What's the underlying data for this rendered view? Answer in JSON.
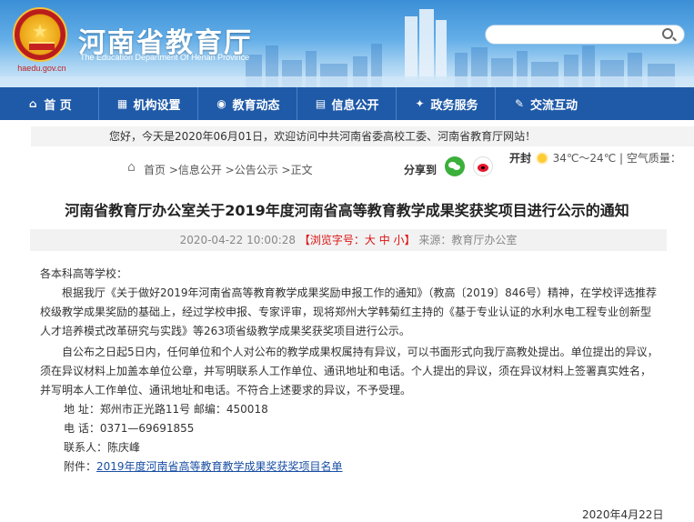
{
  "header": {
    "site_title": "河南省教育厅",
    "site_subtitle": "The Education Department Of Henan Province",
    "domain": "haedu.gov.cn",
    "search_placeholder": ""
  },
  "nav": {
    "items": [
      {
        "label": "首 页",
        "icon": "home-icon"
      },
      {
        "label": "机构设置",
        "icon": "org-icon"
      },
      {
        "label": "教育动态",
        "icon": "news-icon"
      },
      {
        "label": "信息公开",
        "icon": "doc-icon"
      },
      {
        "label": "政务服务",
        "icon": "service-icon"
      },
      {
        "label": "交流互动",
        "icon": "chat-icon"
      }
    ]
  },
  "welcome": "您好，今天是2020年06月01日，欢迎访问中共河南省委高校工委、河南省教育厅网站！",
  "breadcrumb": "首页 >信息公开 >公告公示 >正文",
  "share": {
    "label": "分享到"
  },
  "weather": {
    "city": "开封",
    "temp": "34℃～24℃",
    "air": "| 空气质量："
  },
  "article": {
    "title": "河南省教育厅办公室关于2019年度河南省高等教育教学成果奖获奖项目进行公示的通知",
    "date": "2020-04-22 10:00:28",
    "font_label": "【浏览字号：",
    "size_big": "大",
    "size_mid": "中",
    "size_small": "小",
    "font_end": "】",
    "source": "来源：教育厅办公室",
    "salutation": "各本科高等学校：",
    "para1": "根据我厅《关于做好2019年河南省高等教育教学成果奖励申报工作的通知》（教高〔2019〕846号）精神，在学校评选推荐校级教学成果奖励的基础上，经过学校申报、专家评审，现将郑州大学韩菊红主持的《基于专业认证的水利水电工程专业创新型人才培养模式改革研究与实践》等263项省级教学成果奖获奖项目进行公示。",
    "para2": "自公布之日起5日内，任何单位和个人对公布的教学成果权属持有异议，可以书面形式向我厅高教处提出。单位提出的异议，须在异议材料上加盖本单位公章，并写明联系人工作单位、通讯地址和电话。个人提出的异议，须在异议材料上签署真实姓名，并写明本人工作单位、通讯地址和电话。不符合上述要求的异议，不予受理。",
    "address": "地  址：郑州市正光路11号  邮编：450018",
    "phone": "电  话：0371—69691855",
    "contact": "联系人：陈庆峰",
    "attach_label": "附件：",
    "attach_link": "2019年度河南省高等教育教学成果奖获奖项目名单",
    "sign_date": "2020年4月22日"
  },
  "colors": {
    "nav_bg": "#1f5aa8",
    "link": "#1a4fa3",
    "accent_red": "#d11"
  }
}
